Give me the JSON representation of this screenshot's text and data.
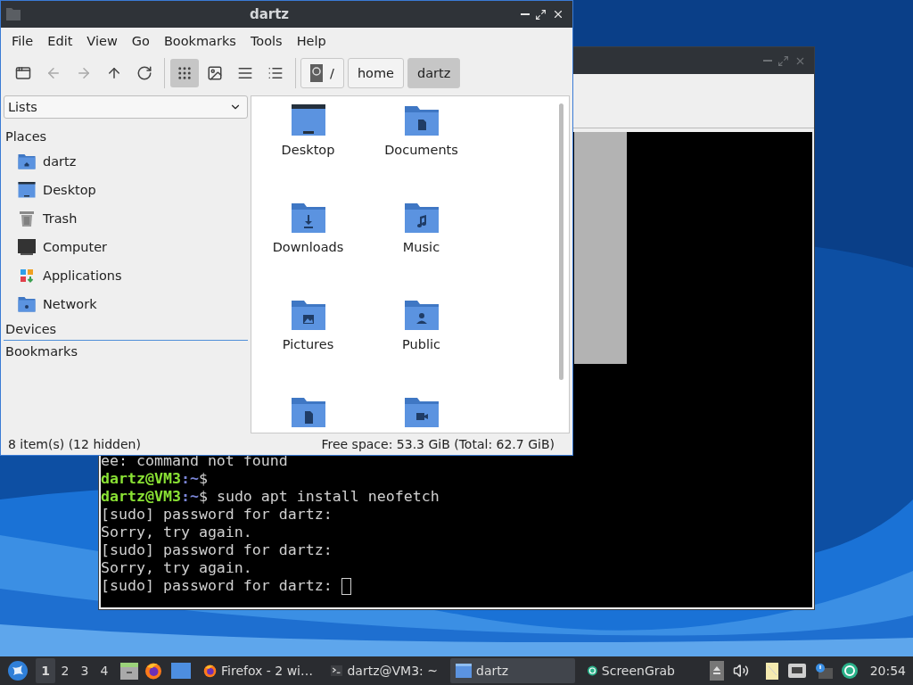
{
  "file_manager": {
    "title": "dartz",
    "menu": [
      "File",
      "Edit",
      "View",
      "Go",
      "Bookmarks",
      "Tools",
      "Help"
    ],
    "nav_buttons": [
      {
        "kind": "new-tab",
        "disabled": false
      },
      {
        "kind": "back",
        "disabled": true
      },
      {
        "kind": "forward",
        "disabled": true
      },
      {
        "kind": "up",
        "disabled": false
      },
      {
        "kind": "reload",
        "disabled": false
      }
    ],
    "view_buttons": [
      {
        "kind": "icons",
        "selected": true
      },
      {
        "kind": "thumbnails",
        "selected": false
      },
      {
        "kind": "compact",
        "selected": false
      },
      {
        "kind": "details",
        "selected": false
      }
    ],
    "path": [
      {
        "label": "/",
        "kind": "root",
        "selected": false
      },
      {
        "label": "home",
        "kind": "dir",
        "selected": false
      },
      {
        "label": "dartz",
        "kind": "dir",
        "selected": true
      }
    ],
    "sidebar": {
      "mode": "Lists",
      "sections": [
        {
          "title": "Places",
          "items": [
            {
              "label": "dartz",
              "kind": "home"
            },
            {
              "label": "Desktop",
              "kind": "desktop"
            },
            {
              "label": "Trash",
              "kind": "trash"
            },
            {
              "label": "Computer",
              "kind": "computer"
            },
            {
              "label": "Applications",
              "kind": "apps"
            },
            {
              "label": "Network",
              "kind": "network"
            }
          ]
        },
        {
          "title": "Devices"
        },
        {
          "title": "Bookmarks"
        }
      ]
    },
    "files": [
      {
        "label": "Desktop",
        "kind": "desktop"
      },
      {
        "label": "Documents",
        "kind": "documents"
      },
      {
        "label": "Downloads",
        "kind": "downloads"
      },
      {
        "label": "Music",
        "kind": "music"
      },
      {
        "label": "Pictures",
        "kind": "pictures"
      },
      {
        "label": "Public",
        "kind": "public"
      },
      {
        "kind": "file"
      },
      {
        "kind": "video"
      }
    ],
    "status_left": "8 item(s) (12 hidden)",
    "status_right": "Free space: 53.3 GiB (Total: 62.7 GiB)"
  },
  "terminal": {
    "lines": [
      {
        "kind": "output",
        "text": "ee: command not found"
      },
      {
        "kind": "prompt",
        "user": "dartz@VM3",
        "path": ":~",
        "dollar": "$"
      },
      {
        "kind": "prompt",
        "user": "dartz@VM3",
        "path": ":~",
        "dollar": "$",
        "command": " sudo apt install neofetch"
      },
      {
        "kind": "output",
        "text": "[sudo] password for dartz:"
      },
      {
        "kind": "output",
        "text": "Sorry, try again."
      },
      {
        "kind": "output",
        "text": "[sudo] password for dartz:"
      },
      {
        "kind": "output",
        "text": "Sorry, try again."
      },
      {
        "kind": "output",
        "text": "[sudo] password for dartz: ",
        "cursor": true
      }
    ]
  },
  "taskbar": {
    "workspaces": [
      {
        "label": "1",
        "selected": true
      },
      {
        "label": "2",
        "selected": false
      },
      {
        "label": "3",
        "selected": false
      },
      {
        "label": "4",
        "selected": false
      }
    ],
    "tasks": [
      {
        "label": "Firefox - 2 wi…",
        "kind": "firefox",
        "selected": false
      },
      {
        "label": "dartz@VM3: ~",
        "kind": "terminal",
        "selected": false
      },
      {
        "label": "dartz",
        "kind": "folder",
        "selected": true
      },
      {
        "label": "ScreenGrab",
        "kind": "screengrab",
        "selected": false
      }
    ],
    "clock": "20:54"
  }
}
